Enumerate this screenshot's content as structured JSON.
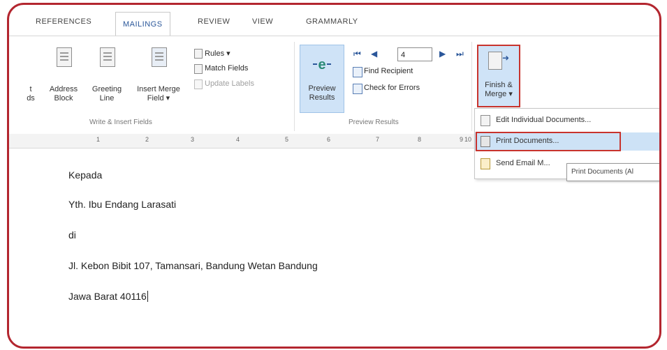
{
  "tabs": [
    {
      "label": "REFERENCES",
      "active": false
    },
    {
      "label": "MAILINGS",
      "active": true
    },
    {
      "label": "REVIEW",
      "active": false
    },
    {
      "label": "VIEW",
      "active": false
    },
    {
      "label": "GRAMMARLY",
      "active": false
    }
  ],
  "ribbon": {
    "partial_left": {
      "line1": "t",
      "line2": "ds"
    },
    "address_block": {
      "line1": "Address",
      "line2": "Block"
    },
    "greeting_line": {
      "line1": "Greeting",
      "line2": "Line"
    },
    "insert_merge_field": {
      "line1": "Insert Merge",
      "line2": "Field ▾"
    },
    "rules": "Rules ▾",
    "match_fields": "Match Fields",
    "update_labels": "Update Labels",
    "write_insert_group": "Write & Insert Fields",
    "preview_results": {
      "line1": "Preview",
      "line2": "Results"
    },
    "record_number": "4",
    "find_recipient": "Find Recipient",
    "check_errors": "Check for Errors",
    "preview_group": "Preview Results",
    "finish_merge": {
      "line1": "Finish &",
      "line2": "Merge ▾"
    }
  },
  "menu": {
    "items": [
      {
        "label": "Edit Individual Documents..."
      },
      {
        "label": "Print Documents..."
      },
      {
        "label": "Send Email M..."
      }
    ]
  },
  "tooltip": "Print Documents (Al",
  "ruler": [
    "1",
    "2",
    "3",
    "4",
    "5",
    "6",
    "7",
    "8",
    "9",
    "10"
  ],
  "document": {
    "lines": [
      "Kepada",
      "Yth. Ibu Endang Larasati",
      "di",
      "Jl. Kebon Bibit 107,  Tamansari, Bandung Wetan Bandung",
      "Jawa Barat 40116"
    ]
  },
  "colors": {
    "highlight": "#c8332d",
    "accent": "#2b579a",
    "hover": "#cde2f6"
  }
}
